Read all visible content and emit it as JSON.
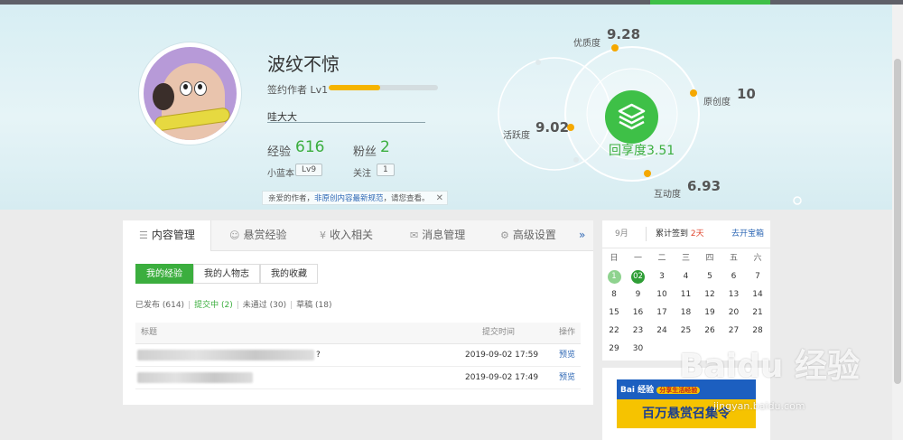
{
  "profile": {
    "name": "波纹不惊",
    "level_label": "签约作者 Lv1",
    "level_progress": 0.47,
    "subtitle": "哇大大",
    "exp_label": "经验",
    "exp_value": "616",
    "fans_label": "粉丝",
    "fans_value": "2",
    "xiaolanben_label": "小蓝本",
    "xiaolanben_value": "Lv9",
    "follow_label": "关注",
    "follow_value": "1",
    "notice_prefix": "亲爱的作者，",
    "notice_link": "非原创内容最新规范",
    "notice_suffix": "，请您查看。",
    "notice_close": "✕"
  },
  "metrics": {
    "quality_label": "优质度",
    "quality_value": "9.28",
    "original_label": "原创度",
    "original_value": "10",
    "active_label": "活跃度",
    "active_value": "9.02",
    "interact_label": "互动度",
    "interact_value": "6.93",
    "center_label": "回享度",
    "center_value": "3.51",
    "accent": "#3ec047",
    "dot_color": "#f5a800"
  },
  "tabs": [
    {
      "label": "内容管理",
      "icon": "list-icon"
    },
    {
      "label": "悬赏经验",
      "icon": "smile-icon"
    },
    {
      "label": "收入相关",
      "icon": "yen-icon"
    },
    {
      "label": "消息管理",
      "icon": "mail-icon"
    },
    {
      "label": "高级设置",
      "icon": "gear-icon"
    }
  ],
  "tabs_more": "»",
  "subtabs": [
    "我的经验",
    "我的人物志",
    "我的收藏"
  ],
  "filters": [
    {
      "label": "已发布 (614)"
    },
    {
      "label": "提交中 (2)"
    },
    {
      "label": "未通过 (30)"
    },
    {
      "label": "草稿 (18)"
    }
  ],
  "table": {
    "headers": [
      "标题",
      "提交时间",
      "操作"
    ],
    "rows": [
      {
        "title_suffix": "?",
        "time": "2019-09-02 17:59",
        "action": "预览"
      },
      {
        "title_suffix": "",
        "time": "2019-09-02 17:49",
        "action": "预览"
      }
    ]
  },
  "calendar": {
    "month": "9月",
    "streak_prefix": "累计签到",
    "streak_days": "2天",
    "link": "去开宝箱",
    "weekdays": [
      "日",
      "一",
      "二",
      "三",
      "四",
      "五",
      "六"
    ],
    "days": [
      "1",
      "2",
      "3",
      "4",
      "5",
      "6",
      "7",
      "8",
      "9",
      "10",
      "11",
      "12",
      "13",
      "14",
      "15",
      "16",
      "17",
      "18",
      "19",
      "20",
      "21",
      "22",
      "23",
      "24",
      "25",
      "26",
      "27",
      "28",
      "29",
      "30"
    ],
    "signed": [
      "1",
      "2"
    ]
  },
  "ad": {
    "brand": "Bai 经验",
    "tag": "分享生活经验",
    "headline": "百万悬赏召集令"
  },
  "watermark": {
    "text": "Baidu 经验",
    "url": "jingyan.baidu.com"
  }
}
